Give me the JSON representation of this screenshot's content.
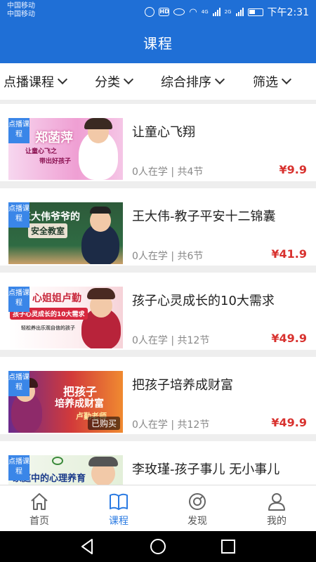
{
  "status_bar": {
    "carrier_1": "中国移动",
    "carrier_2": "中国移动",
    "hd": "HD",
    "net_1": "4G",
    "net_2": "2G",
    "time": "下午2:31"
  },
  "header": {
    "title": "课程"
  },
  "filters": [
    {
      "label": "点播课程"
    },
    {
      "label": "分类"
    },
    {
      "label": "综合排序"
    },
    {
      "label": "筛选"
    }
  ],
  "courses": [
    {
      "title": "让童心飞翔",
      "meta": "0人在学 | 共4节",
      "price": "¥9.9",
      "tag": "点播课程",
      "thumb_text_1": "郑菡萍",
      "thumb_text_2": "让童心飞之",
      "thumb_text_3": "带出好孩子",
      "purchased": ""
    },
    {
      "title": "王大伟-教子平安十二锦囊",
      "meta": "0人在学 | 共6节",
      "price": "¥41.9",
      "tag": "点播课程",
      "thumb_text_1": "王大伟爷爷的",
      "thumb_text_2": "安全教室",
      "thumb_text_3": "",
      "purchased": ""
    },
    {
      "title": "孩子心灵成长的10大需求",
      "meta": "0人在学 | 共12节",
      "price": "¥49.9",
      "tag": "点播课程",
      "thumb_text_1": "心姐姐卢勤",
      "thumb_text_2": "孩子心灵成长的10大需求",
      "thumb_text_3": "轻松养出乐观自信的孩子",
      "purchased": ""
    },
    {
      "title": "把孩子培养成财富",
      "meta": "0人在学 | 共12节",
      "price": "¥49.9",
      "tag": "点播课程",
      "thumb_text_1": "把孩子",
      "thumb_text_2": "培养成财富",
      "thumb_text_3": "卢勤老师",
      "purchased": "已购买"
    },
    {
      "title": "李玫瑾-孩子事儿 无小事儿",
      "meta": "",
      "price": "",
      "tag": "点播课程",
      "thumb_text_1": "家庭中的心理养育",
      "thumb_text_2": "",
      "thumb_text_3": "",
      "purchased": ""
    }
  ],
  "bottom_nav": [
    {
      "label": "首页",
      "icon": "home-icon",
      "active": false
    },
    {
      "label": "课程",
      "icon": "book-icon",
      "active": true
    },
    {
      "label": "发现",
      "icon": "compass-icon",
      "active": false
    },
    {
      "label": "我的",
      "icon": "user-icon",
      "active": false
    }
  ],
  "colors": {
    "primary": "#1f6fd6",
    "active_tab": "#2a7ae2",
    "price": "#d8322f",
    "tag": "#3a86e8"
  }
}
